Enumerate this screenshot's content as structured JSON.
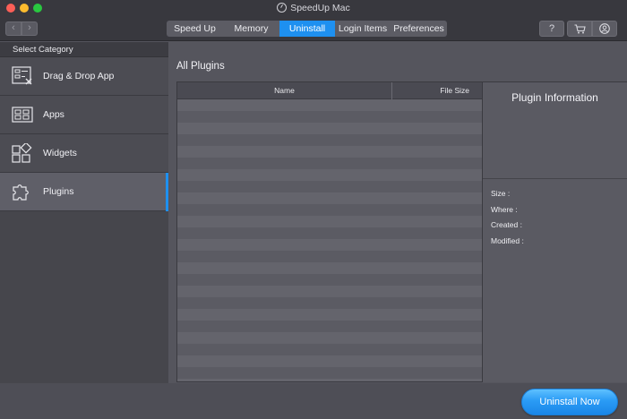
{
  "app": {
    "title": "SpeedUp Mac"
  },
  "nav": {
    "back": "‹",
    "forward": "›"
  },
  "tabs": [
    {
      "label": "Speed Up",
      "active": false
    },
    {
      "label": "Memory",
      "active": false
    },
    {
      "label": "Uninstall",
      "active": true
    },
    {
      "label": "Login Items",
      "active": false
    },
    {
      "label": "Preferences",
      "active": false
    }
  ],
  "toolbar_right": {
    "help": "?",
    "cart_icon": "cart-icon",
    "user_icon": "user-icon"
  },
  "sidebar": {
    "header": "Select Category",
    "items": [
      {
        "label": "Drag & Drop App",
        "icon": "drag-drop-icon",
        "active": false
      },
      {
        "label": "Apps",
        "icon": "apps-icon",
        "active": false
      },
      {
        "label": "Widgets",
        "icon": "widgets-icon",
        "active": false
      },
      {
        "label": "Plugins",
        "icon": "puzzle-icon",
        "active": true
      }
    ]
  },
  "main": {
    "title": "All Plugins",
    "table": {
      "columns": [
        "Name",
        "File Size"
      ],
      "rows": []
    }
  },
  "info_panel": {
    "title": "Plugin Information",
    "fields": [
      "Size :",
      "Where :",
      "Created :",
      "Modified :"
    ]
  },
  "footer": {
    "uninstall_label": "Uninstall Now"
  },
  "colors": {
    "accent": "#1e90f0",
    "window_bg": "#55555d",
    "sidebar_bg": "#46464c"
  }
}
